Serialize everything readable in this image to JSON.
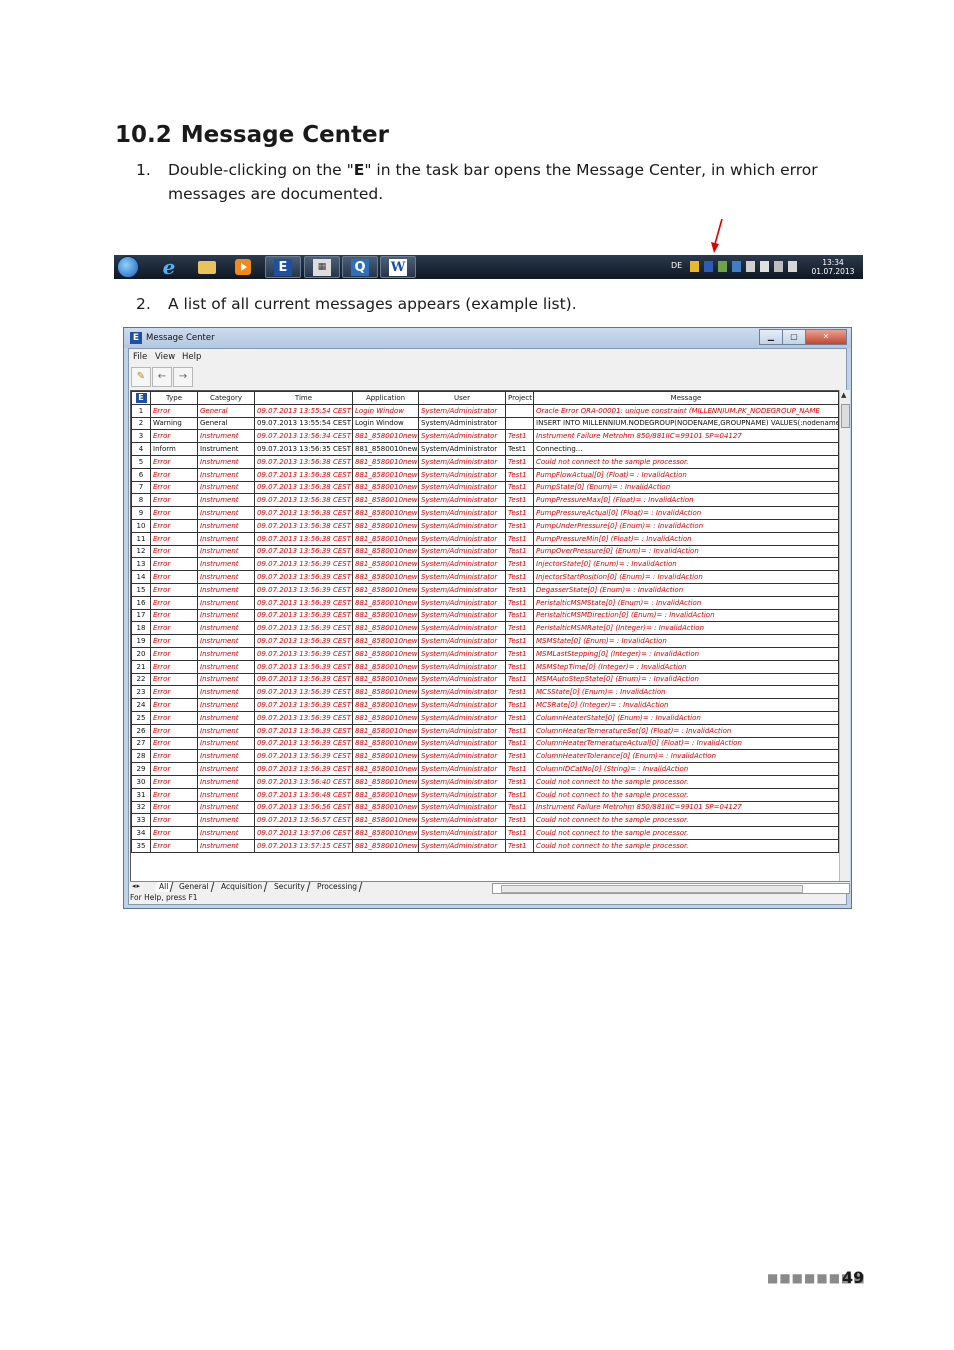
{
  "heading": {
    "number": "10.2",
    "title": "Message Center"
  },
  "steps": [
    {
      "num": "1.",
      "before": "Double-clicking on the \"",
      "bold": "E",
      "after": "\" in the task bar opens the Message Center, in which error messages are documented."
    },
    {
      "num": "2.",
      "text": "A list of all current messages appears (example list)."
    }
  ],
  "taskbar": {
    "icons": [
      "windows-start-icon",
      "internet-explorer-icon",
      "folder-icon",
      "media-player-icon",
      "e-app-icon",
      "calculator-icon",
      "q-app-icon",
      "word-icon"
    ],
    "e_button": "E",
    "q_button": "Q",
    "w_button": "W",
    "language": "DE",
    "clock_time": "13:34",
    "clock_date": "01.07.2013",
    "arrow_color": "#e00000"
  },
  "window": {
    "title": "Message Center",
    "icon_letter": "E",
    "menu": [
      "File",
      "View",
      "Help"
    ],
    "columns": [
      "Type",
      "Category",
      "Time",
      "Application",
      "User",
      "Project",
      "Message"
    ],
    "rows": [
      [
        "1",
        "Error",
        "General",
        "09.07.2013 13:55:54 CEST",
        "Login Window",
        "System/Administrator",
        "",
        "Oracle Error ORA-00001: unique constraint (MILLENNIUM.PK_NODEGROUP_NAME"
      ],
      [
        "2",
        "Warning",
        "General",
        "09.07.2013 13:55:54 CEST",
        "Login Window",
        "System/Administrator",
        "",
        "INSERT INTO MILLENNIUM.NODEGROUP(NODENAME,GROUPNAME) VALUES(:nodename,:gr"
      ],
      [
        "3",
        "Error",
        "Instrument",
        "09.07.2013 13:56:34 CEST",
        "881_8580010new",
        "System/Administrator",
        "Test1",
        "Instrument Failure Metrohm 850/881IIC=99101 SP=04127"
      ],
      [
        "4",
        "Inform",
        "Instrument",
        "09.07.2013 13:56:35 CEST",
        "881_8580010new",
        "System/Administrator",
        "Test1",
        "Connecting..."
      ],
      [
        "5",
        "Error",
        "Instrument",
        "09.07.2013 13:56:38 CEST",
        "881_8580010new",
        "System/Administrator",
        "Test1",
        "Could not connect to the sample processor."
      ],
      [
        "6",
        "Error",
        "Instrument",
        "09.07.2013 13:56:38 CEST",
        "881_8580010new",
        "System/Administrator",
        "Test1",
        "PumpFlowActual[0] (Float)= : InvalidAction"
      ],
      [
        "7",
        "Error",
        "Instrument",
        "09.07.2013 13:56:38 CEST",
        "881_8580010new",
        "System/Administrator",
        "Test1",
        "PumpState[0] (Enum)= : InvalidAction"
      ],
      [
        "8",
        "Error",
        "Instrument",
        "09.07.2013 13:56:38 CEST",
        "881_8580010new",
        "System/Administrator",
        "Test1",
        "PumpPressureMax[0] (Float)= : InvalidAction"
      ],
      [
        "9",
        "Error",
        "Instrument",
        "09.07.2013 13:56:38 CEST",
        "881_8580010new",
        "System/Administrator",
        "Test1",
        "PumpPressureActual[0] (Float)= : InvalidAction"
      ],
      [
        "10",
        "Error",
        "Instrument",
        "09.07.2013 13:56:38 CEST",
        "881_8580010new",
        "System/Administrator",
        "Test1",
        "PumpUnderPressure[0] (Enum)= : InvalidAction"
      ],
      [
        "11",
        "Error",
        "Instrument",
        "09.07.2013 13:56:38 CEST",
        "881_8580010new",
        "System/Administrator",
        "Test1",
        "PumpPressureMin[0] (Float)= : InvalidAction"
      ],
      [
        "12",
        "Error",
        "Instrument",
        "09.07.2013 13:56:39 CEST",
        "881_8580010new",
        "System/Administrator",
        "Test1",
        "PumpOverPressure[0] (Enum)= : InvalidAction"
      ],
      [
        "13",
        "Error",
        "Instrument",
        "09.07.2013 13:56:39 CEST",
        "881_8580010new",
        "System/Administrator",
        "Test1",
        "InjectorState[0] (Enum)= : InvalidAction"
      ],
      [
        "14",
        "Error",
        "Instrument",
        "09.07.2013 13:56:39 CEST",
        "881_8580010new",
        "System/Administrator",
        "Test1",
        "InjectorStartPosition[0] (Enum)= : InvalidAction"
      ],
      [
        "15",
        "Error",
        "Instrument",
        "09.07.2013 13:56:39 CEST",
        "881_8580010new",
        "System/Administrator",
        "Test1",
        "DegasserState[0] (Enum)= : InvalidAction"
      ],
      [
        "16",
        "Error",
        "Instrument",
        "09.07.2013 13:56:39 CEST",
        "881_8580010new",
        "System/Administrator",
        "Test1",
        "PeristalticMSMState[0] (Enum)= : InvalidAction"
      ],
      [
        "17",
        "Error",
        "Instrument",
        "09.07.2013 13:56:39 CEST",
        "881_8580010new",
        "System/Administrator",
        "Test1",
        "PeristalticMSMDirection[0] (Enum)= : InvalidAction"
      ],
      [
        "18",
        "Error",
        "Instrument",
        "09.07.2013 13:56:39 CEST",
        "881_8580010new",
        "System/Administrator",
        "Test1",
        "PeristalticMSMRate[0] (Integer)= : InvalidAction"
      ],
      [
        "19",
        "Error",
        "Instrument",
        "09.07.2013 13:56:39 CEST",
        "881_8580010new",
        "System/Administrator",
        "Test1",
        "MSMState[0] (Enum)= : InvalidAction"
      ],
      [
        "20",
        "Error",
        "Instrument",
        "09.07.2013 13:56:39 CEST",
        "881_8580010new",
        "System/Administrator",
        "Test1",
        "MSMLastStepping[0] (Integer)= : InvalidAction"
      ],
      [
        "21",
        "Error",
        "Instrument",
        "09.07.2013 13:56:39 CEST",
        "881_8580010new",
        "System/Administrator",
        "Test1",
        "MSMStepTime[0] (Integer)= : InvalidAction"
      ],
      [
        "22",
        "Error",
        "Instrument",
        "09.07.2013 13:56:39 CEST",
        "881_8580010new",
        "System/Administrator",
        "Test1",
        "MSMAutoStepState[0] (Enum)= : InvalidAction"
      ],
      [
        "23",
        "Error",
        "Instrument",
        "09.07.2013 13:56:39 CEST",
        "881_8580010new",
        "System/Administrator",
        "Test1",
        "MCSState[0] (Enum)= : InvalidAction"
      ],
      [
        "24",
        "Error",
        "Instrument",
        "09.07.2013 13:56:39 CEST",
        "881_8580010new",
        "System/Administrator",
        "Test1",
        "MCSRate[0] (Integer)= : InvalidAction"
      ],
      [
        "25",
        "Error",
        "Instrument",
        "09.07.2013 13:56:39 CEST",
        "881_8580010new",
        "System/Administrator",
        "Test1",
        "ColumnHeaterState[0] (Enum)= : InvalidAction"
      ],
      [
        "26",
        "Error",
        "Instrument",
        "09.07.2013 13:56:39 CEST",
        "881_8580010new",
        "System/Administrator",
        "Test1",
        "ColumnHeaterTemeratureSet[0] (Float)= : InvalidAction"
      ],
      [
        "27",
        "Error",
        "Instrument",
        "09.07.2013 13:56:39 CEST",
        "881_8580010new",
        "System/Administrator",
        "Test1",
        "ColumnHeaterTemeratureActual[0] (Float)= : InvalidAction"
      ],
      [
        "28",
        "Error",
        "Instrument",
        "09.07.2013 13:56:39 CEST",
        "881_8580010new",
        "System/Administrator",
        "Test1",
        "ColumnHeaterTolerance[0] (Enum)= : InvalidAction"
      ],
      [
        "29",
        "Error",
        "Instrument",
        "09.07.2013 13:56:39 CEST",
        "881_8580010new",
        "System/Administrator",
        "Test1",
        "ColumnIDCatNo[0] (String)= : InvalidAction"
      ],
      [
        "30",
        "Error",
        "Instrument",
        "09.07.2013 13:56:40 CEST",
        "881_8580010new",
        "System/Administrator",
        "Test1",
        "Could not connect to the sample processor."
      ],
      [
        "31",
        "Error",
        "Instrument",
        "09.07.2013 13:56:48 CEST",
        "881_8580010new",
        "System/Administrator",
        "Test1",
        "Could not connect to the sample processor."
      ],
      [
        "32",
        "Error",
        "Instrument",
        "09.07.2013 13:56:56 CEST",
        "881_8580010new",
        "System/Administrator",
        "Test1",
        "Instrument Failure Metrohm 850/881IIC=99101 SP=04127"
      ],
      [
        "33",
        "Error",
        "Instrument",
        "09.07.2013 13:56:57 CEST",
        "881_8580010new",
        "System/Administrator",
        "Test1",
        "Could not connect to the sample processor."
      ],
      [
        "34",
        "Error",
        "Instrument",
        "09.07.2013 13:57:06 CEST",
        "881_8580010new",
        "System/Administrator",
        "Test1",
        "Could not connect to the sample processor."
      ],
      [
        "35",
        "Error",
        "Instrument",
        "09.07.2013 13:57:15 CEST",
        "881_8580010new",
        "System/Administrator",
        "Test1",
        "Could not connect to the sample processor."
      ]
    ],
    "tabs": [
      "All",
      "General",
      "Acquisition",
      "Security",
      "Processing"
    ],
    "status": "For Help, press F1",
    "error_color": "#e00000"
  },
  "footer": {
    "page_number": "49"
  }
}
